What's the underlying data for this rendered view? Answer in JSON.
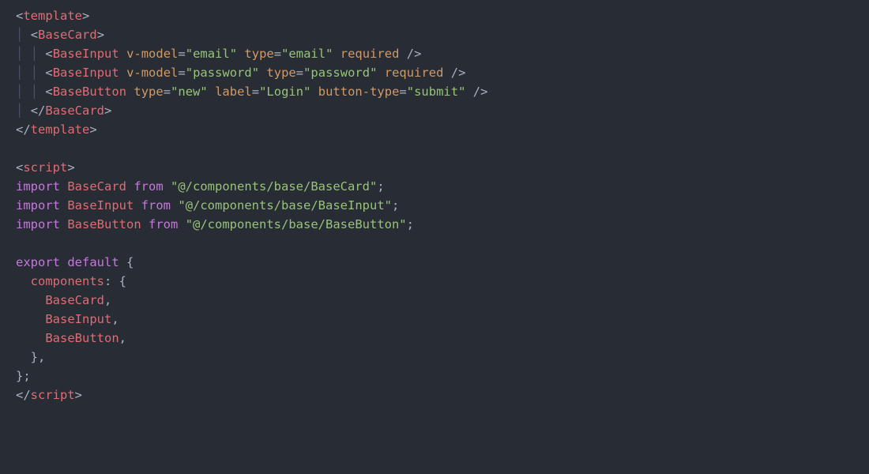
{
  "code": {
    "tags": {
      "template": "template",
      "BaseCard": "BaseCard",
      "BaseInput": "BaseInput",
      "BaseButton": "BaseButton",
      "script": "script"
    },
    "attrs": {
      "vmodel": "v-model",
      "type": "type",
      "required": "required",
      "label": "label",
      "buttonType": "button-type"
    },
    "strings": {
      "email": "\"email\"",
      "password": "\"password\"",
      "newStr": "\"new\"",
      "login": "\"Login\"",
      "submit": "\"submit\"",
      "pathCard": "\"@/components/base/BaseCard\"",
      "pathInput": "\"@/components/base/BaseInput\"",
      "pathButton": "\"@/components/base/BaseButton\""
    },
    "kw": {
      "import": "import",
      "from": "from",
      "export": "export",
      "default": "default"
    },
    "ids": {
      "BaseCard": "BaseCard",
      "BaseInput": "BaseInput",
      "BaseButton": "BaseButton"
    },
    "obj": {
      "components": "components"
    },
    "punct": {
      "lt": "<",
      "gt": ">",
      "ltSlash": "</",
      "slashGt": "/>",
      "eq": "=",
      "openBrace": "{",
      "closeBrace": "}",
      "closeBraceSemi": "};",
      "colonSpaceBrace": ": {",
      "comma": ",",
      "closeBraceComma": "},",
      "semi": ";",
      "guide": "│"
    }
  }
}
